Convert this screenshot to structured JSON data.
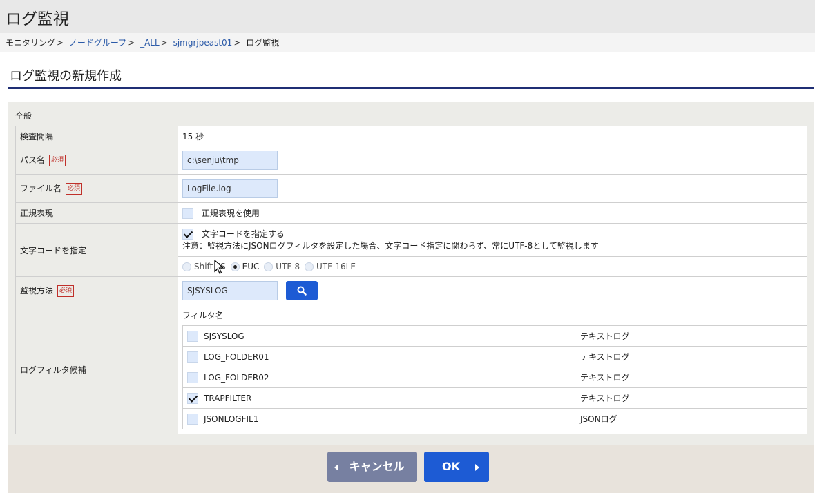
{
  "page": {
    "title": "ログ監視"
  },
  "breadcrumb": {
    "items": [
      {
        "label": "モニタリング",
        "link": false
      },
      {
        "label": "ノードグループ",
        "link": true
      },
      {
        "label": "_ALL",
        "link": true
      },
      {
        "label": "sjmgrjpeast01",
        "link": true
      },
      {
        "label": "ログ監視",
        "link": false
      }
    ],
    "separator": ">"
  },
  "section": {
    "title": "ログ監視の新規作成"
  },
  "form": {
    "group_label": "全般",
    "required_badge": "必須",
    "interval": {
      "label": "検査間隔",
      "value": "15 秒"
    },
    "path": {
      "label": "パス名",
      "value": "c:\\senju\\tmp"
    },
    "file": {
      "label": "ファイル名",
      "value": "LogFile.log"
    },
    "regex": {
      "label": "正規表現",
      "checkbox_label": "正規表現を使用",
      "checked": false
    },
    "charcode": {
      "label": "文字コードを指定",
      "checkbox_label": "文字コードを指定する",
      "checked": true,
      "note": "注意：監視方法にJSONログフィルタを設定した場合、文字コード指定に関わらず、常にUTF-8として監視します",
      "options": [
        "Shift JIS",
        "EUC",
        "UTF-8",
        "UTF-16LE"
      ],
      "selected": "EUC"
    },
    "method": {
      "label": "監視方法",
      "value": "SJSYSLOG",
      "search_icon": "search-icon"
    },
    "filters": {
      "label": "ログフィルタ候補",
      "header": "フィルタ名",
      "rows": [
        {
          "name": "SJSYSLOG",
          "kind": "テキストログ",
          "checked": false
        },
        {
          "name": "LOG_FOLDER01",
          "kind": "テキストログ",
          "checked": false
        },
        {
          "name": "LOG_FOLDER02",
          "kind": "テキストログ",
          "checked": false
        },
        {
          "name": "TRAPFILTER",
          "kind": "テキストログ",
          "checked": true
        },
        {
          "name": "JSONLOGFIL1",
          "kind": "JSONログ",
          "checked": false
        }
      ]
    }
  },
  "footer": {
    "cancel_label": "キャンセル",
    "ok_label": "OK"
  },
  "colors": {
    "accent": "#1d5bd4",
    "cancel": "#7780a1",
    "heading_rule": "#1f2e74",
    "required": "#c0302a"
  }
}
